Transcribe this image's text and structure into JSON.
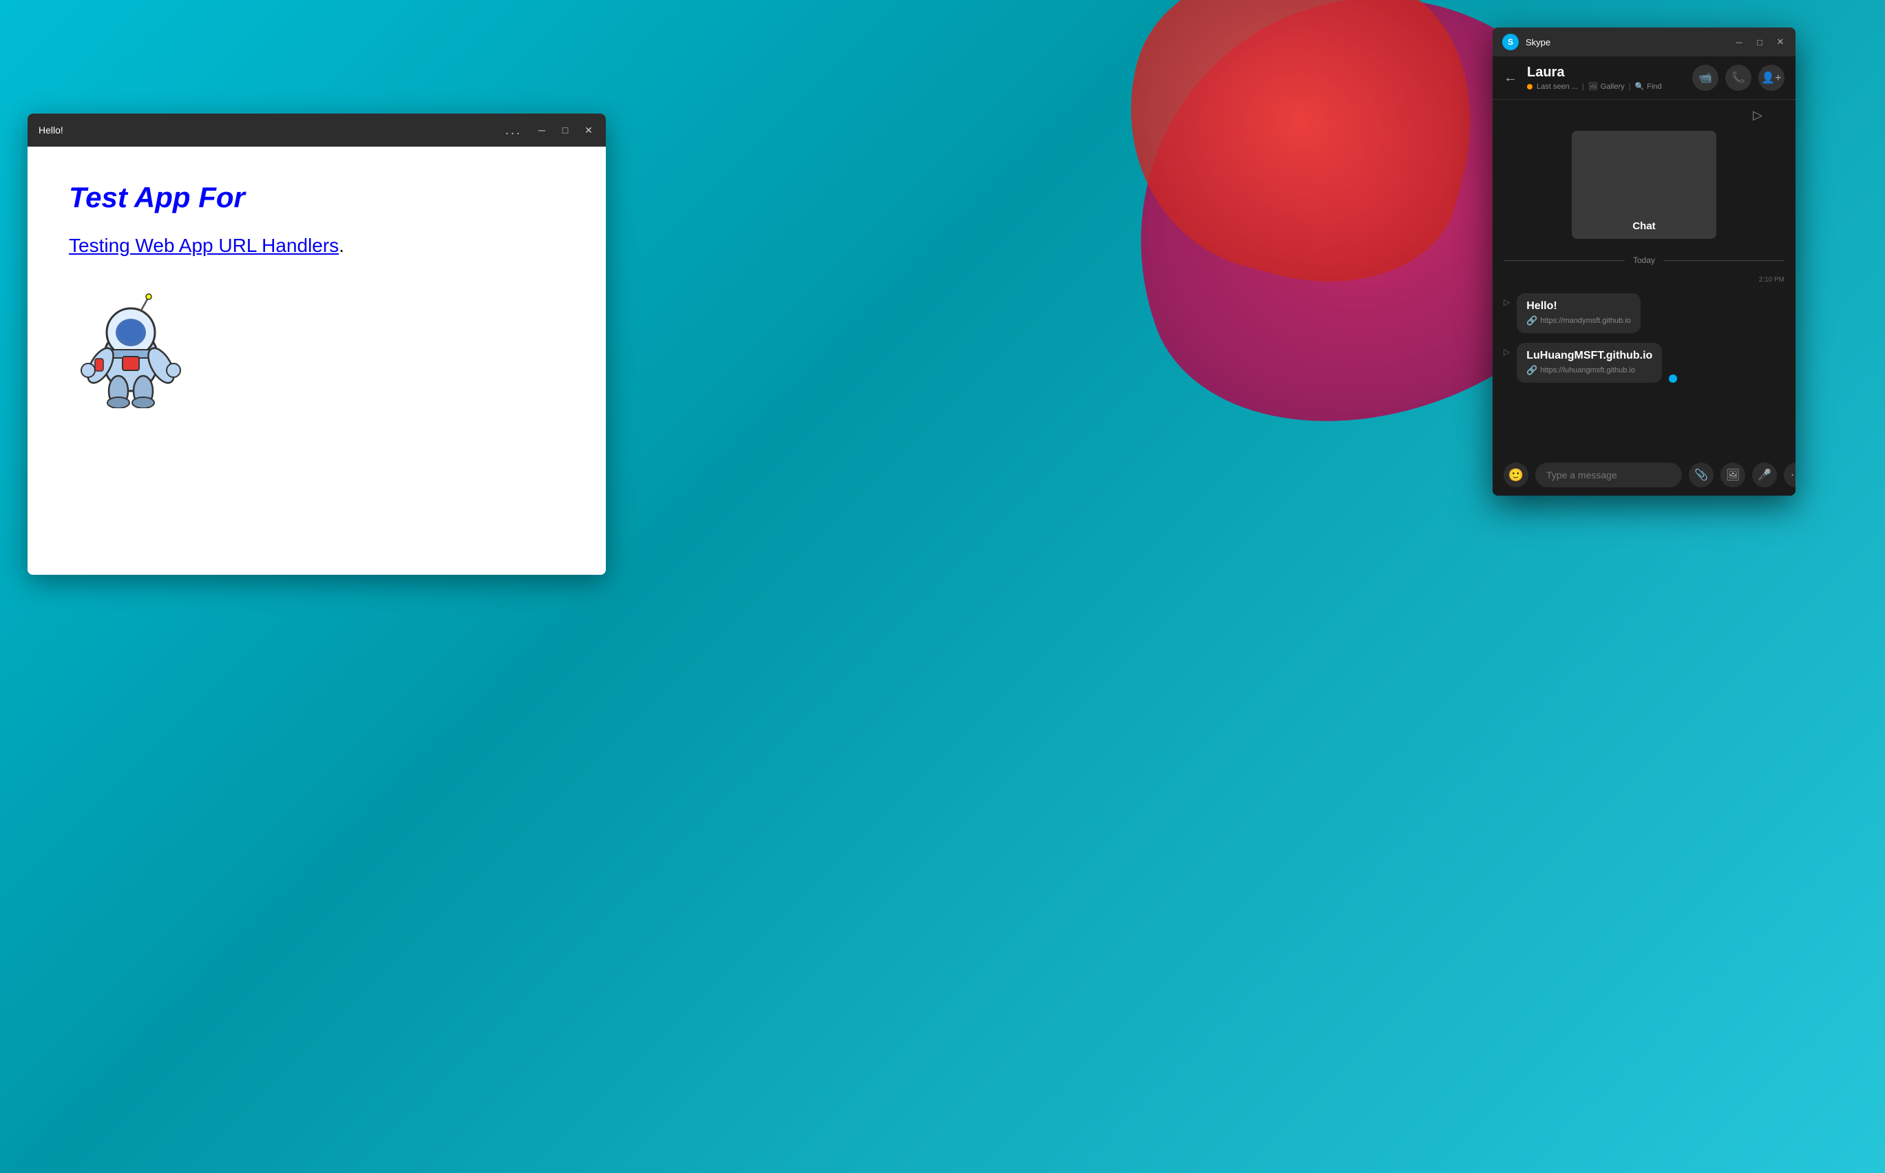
{
  "desktop": {
    "bg_color": "#00bcd4"
  },
  "webapp": {
    "title": "Hello!",
    "titlebar_dots": "...",
    "minimize_label": "─",
    "maximize_label": "□",
    "close_label": "✕",
    "heading": "Test App For",
    "link_text": "Testing Web App URL Handlers",
    "link_dot": ".",
    "astronaut_alt": "astronaut illustration"
  },
  "skype": {
    "app_name": "Skype",
    "logo_letter": "S",
    "minimize_label": "─",
    "maximize_label": "□",
    "close_label": "✕",
    "contact_name": "Laura",
    "status_text": "Last seen ...",
    "gallery_label": "Gallery",
    "find_label": "Find",
    "share_card_label": "Chat",
    "today_label": "Today",
    "message_time": "2:10 PM",
    "message1_text": "Hello!",
    "message1_link": "https://mandymsft.github.io",
    "message2_text": "LuHuangMSFT.github.io",
    "message2_link": "https://luhuangmsft.github.io",
    "input_placeholder": "Type a message",
    "emoji_icon": "🙂",
    "attach_icon": "📎",
    "image_icon": "🖼",
    "mic_icon": "🎤",
    "more_icon": "⋯"
  }
}
